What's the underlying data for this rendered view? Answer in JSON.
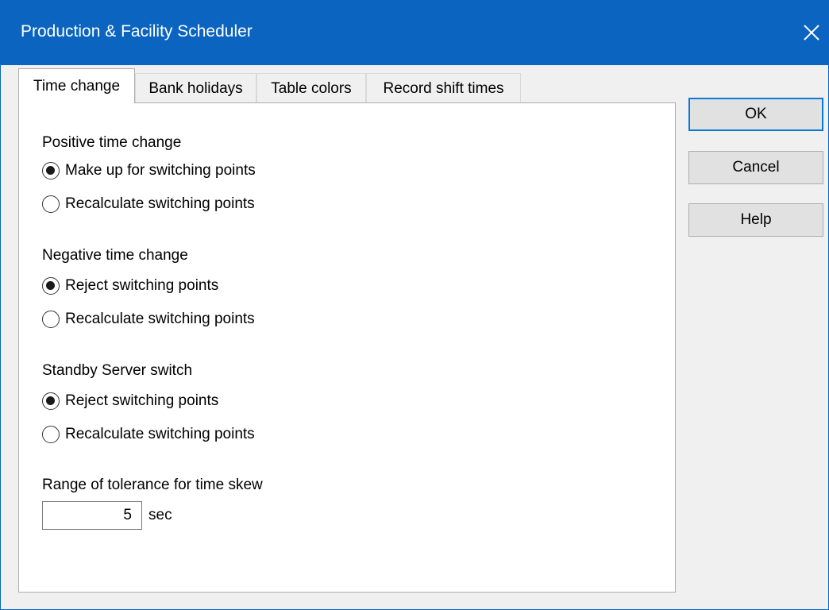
{
  "window": {
    "title": "Production & Facility Scheduler",
    "accent_color": "#0a64c0",
    "close_icon": "close-icon"
  },
  "tabs": [
    {
      "label": "Time change",
      "active": true
    },
    {
      "label": "Bank holidays",
      "active": false
    },
    {
      "label": "Table colors",
      "active": false
    },
    {
      "label": "Record shift times",
      "active": false
    }
  ],
  "time_change": {
    "positive": {
      "label": "Positive time change",
      "options": [
        {
          "label": "Make up for switching points",
          "selected": true
        },
        {
          "label": "Recalculate switching points",
          "selected": false
        }
      ]
    },
    "negative": {
      "label": "Negative time change",
      "options": [
        {
          "label": "Reject switching points",
          "selected": true
        },
        {
          "label": "Recalculate switching points",
          "selected": false
        }
      ]
    },
    "standby": {
      "label": "Standby Server switch",
      "options": [
        {
          "label": "Reject switching points",
          "selected": true
        },
        {
          "label": "Recalculate switching points",
          "selected": false
        }
      ]
    },
    "tolerance": {
      "label": "Range of tolerance for time skew",
      "value": "5",
      "unit": "sec"
    }
  },
  "buttons": {
    "ok": "OK",
    "cancel": "Cancel",
    "help": "Help"
  }
}
